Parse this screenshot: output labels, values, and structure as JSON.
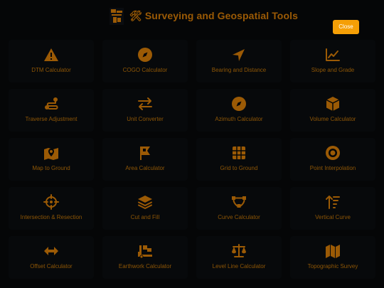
{
  "header": {
    "title": "🛠 Surveying and Geospatial Tools",
    "close_label": "Close"
  },
  "colors": {
    "background": "#050607",
    "accent": "#f59f06",
    "icon_text": "#9b5a05"
  },
  "tools": [
    {
      "label": "DTM Calculator",
      "icon": "warning-triangle-icon"
    },
    {
      "label": "COGO Calculator",
      "icon": "compass-icon"
    },
    {
      "label": "Bearing and Distance",
      "icon": "location-arrow-icon"
    },
    {
      "label": "Slope and Grade",
      "icon": "line-chart-icon"
    },
    {
      "label": "Traverse Adjustment",
      "icon": "route-icon"
    },
    {
      "label": "Unit Converter",
      "icon": "exchange-arrows-icon"
    },
    {
      "label": "Azimuth Calculator",
      "icon": "compass-icon"
    },
    {
      "label": "Volume Calculator",
      "icon": "cube-icon"
    },
    {
      "label": "Map to Ground",
      "icon": "map-pin-icon"
    },
    {
      "label": "Area Calculator",
      "icon": "flag-area-icon"
    },
    {
      "label": "Grid to Ground",
      "icon": "grid-icon"
    },
    {
      "label": "Point Interpolation",
      "icon": "target-dot-icon"
    },
    {
      "label": "Intersection & Resection",
      "icon": "crosshair-icon"
    },
    {
      "label": "Cut and Fill",
      "icon": "layers-icon"
    },
    {
      "label": "Curve Calculator",
      "icon": "bezier-curve-icon"
    },
    {
      "label": "Vertical Curve",
      "icon": "sort-arrows-icon"
    },
    {
      "label": "Offset Calculator",
      "icon": "horizontal-arrows-icon"
    },
    {
      "label": "Earthwork Calculator",
      "icon": "truck-loading-icon"
    },
    {
      "label": "Level Line Calculator",
      "icon": "balance-scale-icon"
    },
    {
      "label": "Topographic Survey",
      "icon": "map-icon"
    }
  ]
}
